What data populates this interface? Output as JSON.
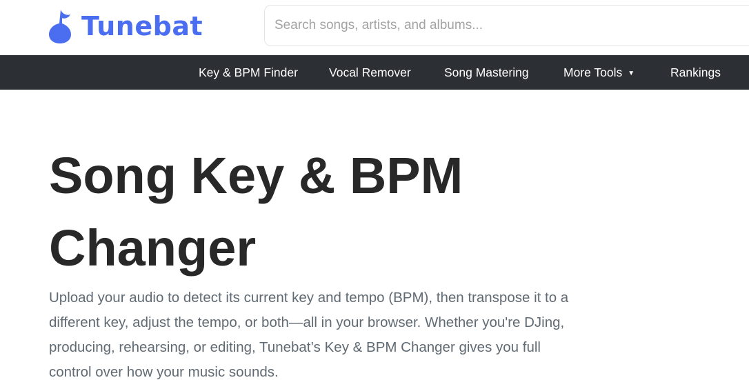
{
  "brand": {
    "name": "Tunebat",
    "color": "#4b6ef0"
  },
  "search": {
    "placeholder": "Search songs, artists, and albums...",
    "value": ""
  },
  "nav": {
    "background": "#2c2f33",
    "items": [
      {
        "label": "Key & BPM Finder"
      },
      {
        "label": "Vocal Remover"
      },
      {
        "label": "Song Mastering"
      },
      {
        "label": "More Tools",
        "has_dropdown": true,
        "caret": "▼"
      },
      {
        "label": "Rankings"
      }
    ]
  },
  "main": {
    "title": "Song Key & BPM Changer",
    "intro": "Upload your audio to detect its current key and tempo (BPM), then transpose it to a different key, adjust the tempo, or both—all in your browser. Whether you're DJing, producing, rehearsing, or editing, Tunebat’s Key & BPM Changer gives you full control over how your music sounds."
  },
  "icons": {
    "logo": "music-note-icon",
    "dropdown": "caret-down-icon"
  }
}
